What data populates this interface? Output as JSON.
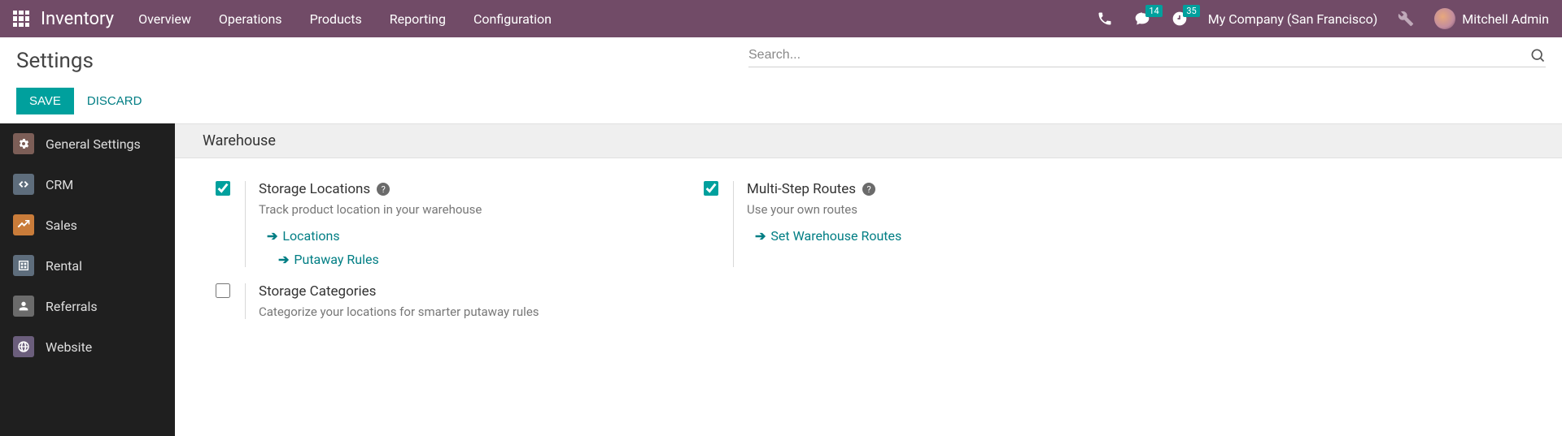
{
  "topbar": {
    "app_title": "Inventory",
    "menu": [
      "Overview",
      "Operations",
      "Products",
      "Reporting",
      "Configuration"
    ],
    "badges": {
      "messages": "14",
      "activities": "35"
    },
    "company": "My Company (San Francisco)",
    "user": "Mitchell Admin"
  },
  "control": {
    "page_title": "Settings",
    "search_placeholder": "Search...",
    "save_label": "Save",
    "discard_label": "Discard"
  },
  "sidebar": {
    "items": [
      {
        "label": "General Settings"
      },
      {
        "label": "CRM"
      },
      {
        "label": "Sales"
      },
      {
        "label": "Rental"
      },
      {
        "label": "Referrals"
      },
      {
        "label": "Website"
      }
    ]
  },
  "section_title": "Warehouse",
  "settings": {
    "storage_locations": {
      "title": "Storage Locations",
      "desc": "Track product location in your warehouse",
      "link1": "Locations",
      "link2": "Putaway Rules",
      "checked": true
    },
    "multi_step_routes": {
      "title": "Multi-Step Routes",
      "desc": "Use your own routes",
      "link1": "Set Warehouse Routes",
      "checked": true
    },
    "storage_categories": {
      "title": "Storage Categories",
      "desc": "Categorize your locations for smarter putaway rules",
      "checked": false
    }
  }
}
